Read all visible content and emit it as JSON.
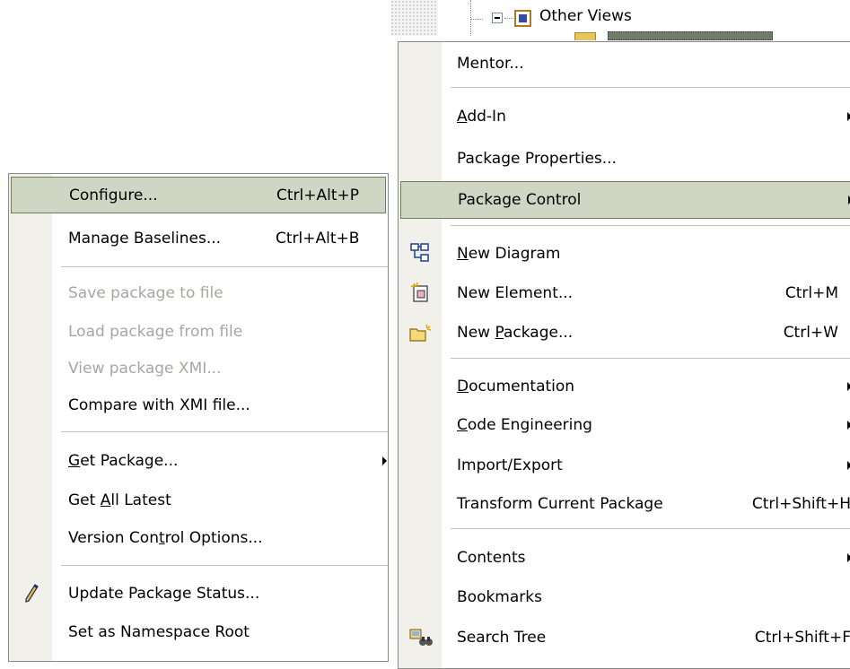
{
  "tree": {
    "node_label": "Other Views"
  },
  "left_menu": {
    "items": [
      {
        "label": "Configure...",
        "shortcut": "Ctrl+Alt+P"
      },
      {
        "label": "Manage Baselines...",
        "shortcut": "Ctrl+Alt+B"
      },
      {
        "label": "Save package to file"
      },
      {
        "label": "Load package from file"
      },
      {
        "label": "View package XMI..."
      },
      {
        "label": "Compare with XMI file..."
      },
      {
        "label_pre": "",
        "label_u": "G",
        "label_post": "et Package..."
      },
      {
        "label_pre": "Get ",
        "label_u": "A",
        "label_post": "ll Latest"
      },
      {
        "label_pre": "Version Con",
        "label_u": "t",
        "label_post": "rol Options..."
      },
      {
        "label": "Update Package Status..."
      },
      {
        "label": "Set as Namespace Root"
      }
    ]
  },
  "right_menu": {
    "items": [
      {
        "label": "Mentor..."
      },
      {
        "label_pre": "",
        "label_u": "A",
        "label_post": "dd-In"
      },
      {
        "label": "Package Properties..."
      },
      {
        "label": "Package Control"
      },
      {
        "label_pre": "",
        "label_u": "N",
        "label_post": "ew Diagram"
      },
      {
        "label": "New Element...",
        "shortcut": "Ctrl+M"
      },
      {
        "label_pre": "New ",
        "label_u": "P",
        "label_post": "ackage...",
        "shortcut": "Ctrl+W"
      },
      {
        "label_pre": "",
        "label_u": "D",
        "label_post": "ocumentation"
      },
      {
        "label_pre": "",
        "label_u": "C",
        "label_post": "ode Engineering"
      },
      {
        "label": "Import/Export"
      },
      {
        "label": "Transform Current Package",
        "shortcut": "Ctrl+Shift+H"
      },
      {
        "label": "Contents"
      },
      {
        "label": "Bookmarks"
      },
      {
        "label": "Search Tree",
        "shortcut": "Ctrl+Shift+F"
      }
    ]
  },
  "colors": {
    "highlight": "#cfd6c3",
    "highlight_border": "#6f7f5d",
    "gutter": "#f1f0ea",
    "disabled_text": "#a7a6a0"
  }
}
